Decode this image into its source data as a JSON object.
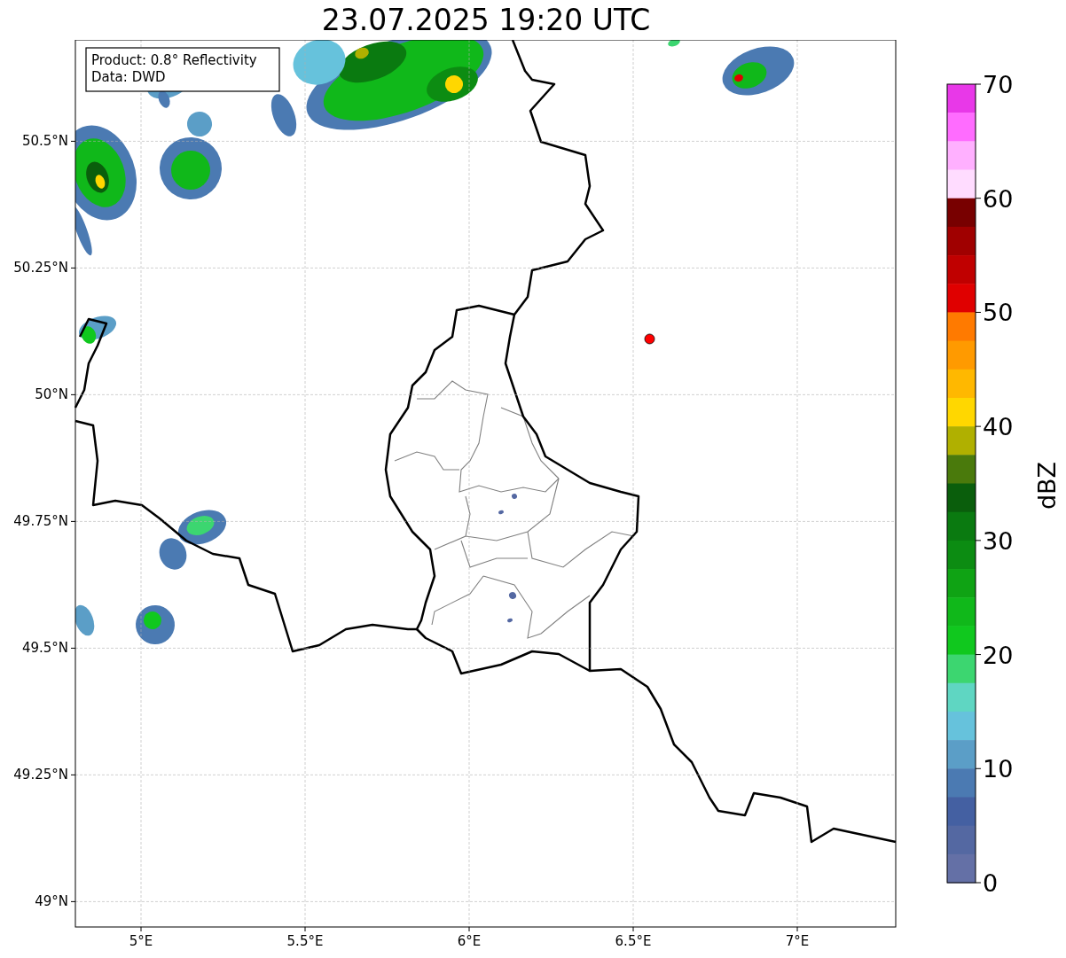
{
  "title": "23.07.2025 19:20 UTC",
  "map": {
    "info_box": [
      "Product: 0.8° Reflectivity",
      "Data: DWD"
    ],
    "chart_data": {
      "type": "scatter",
      "x": [
        6.55
      ],
      "grid": true,
      "series": [
        {
          "color": "#ff0000",
          "values": [
            50.11
          ]
        }
      ],
      "xlim": [
        4.8,
        7.3
      ],
      "ylim": [
        48.95,
        50.7
      ],
      "xticks": [
        {
          "value": 5,
          "label": "5°E"
        },
        {
          "value": 5.5,
          "label": "5.5°E"
        },
        {
          "value": 6,
          "label": "6°E"
        },
        {
          "value": 6.5,
          "label": "6.5°E"
        },
        {
          "value": 7,
          "label": "7°E"
        }
      ],
      "yticks": [
        {
          "value": 50.5,
          "label": "50.5°N"
        },
        {
          "value": 50.25,
          "label": "50.25°N"
        },
        {
          "value": 50,
          "label": "50°N"
        },
        {
          "value": 49.75,
          "label": "49.75°N"
        },
        {
          "value": 49.5,
          "label": "49.5°N"
        },
        {
          "value": 49.25,
          "label": "49.25°N"
        },
        {
          "value": 49,
          "label": "49°N"
        }
      ]
    }
  },
  "colorbar": {
    "label": "dBZ",
    "ticks": [
      "70",
      "60",
      "50",
      "40",
      "30",
      "20",
      "10",
      "0"
    ],
    "segments": [
      {
        "color": "#e838e8"
      },
      {
        "color": "#ff6cff"
      },
      {
        "color": "#ffb0ff"
      },
      {
        "color": "#ffdcff"
      },
      {
        "color": "#780000"
      },
      {
        "color": "#a00000"
      },
      {
        "color": "#c00000"
      },
      {
        "color": "#e00000"
      },
      {
        "color": "#ff7a00"
      },
      {
        "color": "#ff9a00"
      },
      {
        "color": "#ffb800"
      },
      {
        "color": "#ffd700"
      },
      {
        "color": "#b0b000"
      },
      {
        "color": "#4a7a0c"
      },
      {
        "color": "#0a5e0c"
      },
      {
        "color": "#0a7a10"
      },
      {
        "color": "#0c8c12"
      },
      {
        "color": "#0fa314"
      },
      {
        "color": "#10b81a"
      },
      {
        "color": "#10c81e"
      },
      {
        "color": "#3cd670"
      },
      {
        "color": "#5fd6c2"
      },
      {
        "color": "#66c2dc"
      },
      {
        "color": "#5b9ec7"
      },
      {
        "color": "#4b7ab2"
      },
      {
        "color": "#4460a2"
      },
      {
        "color": "#5468a2"
      },
      {
        "color": "#6470a6"
      }
    ]
  }
}
